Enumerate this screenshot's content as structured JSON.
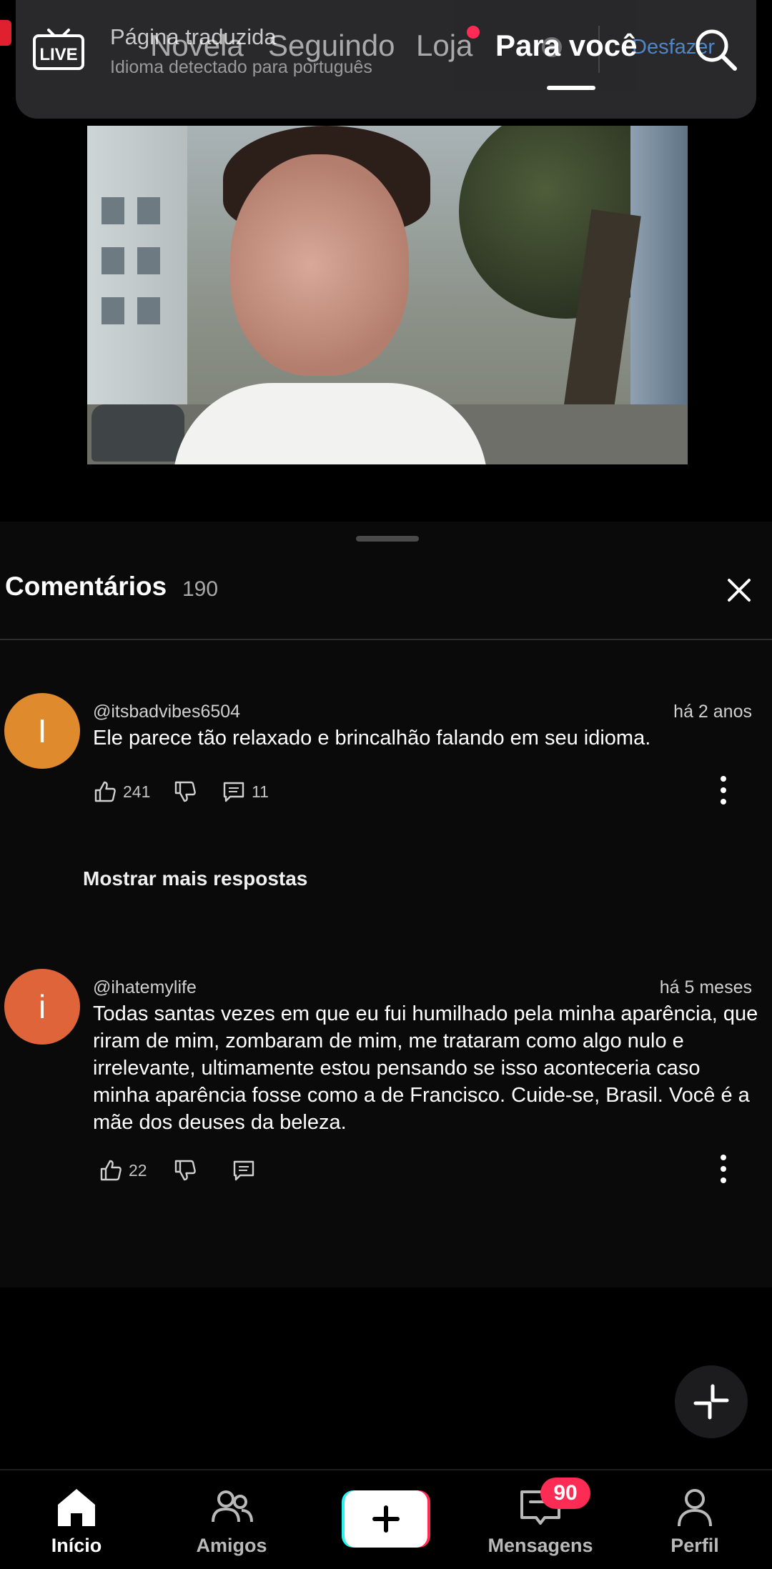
{
  "translation_banner": {
    "title": "Página traduzida",
    "subtitle": "Idioma detectado para português",
    "undo_label": "Desfazer"
  },
  "header": {
    "live_label": "LIVE",
    "tabs": [
      {
        "label": "Novela",
        "active": false
      },
      {
        "label": "Seguindo",
        "active": false
      },
      {
        "label": "Loja",
        "active": false,
        "has_dot": true
      },
      {
        "label": "Para você",
        "active": true
      }
    ]
  },
  "comments_sheet": {
    "title": "Comentários",
    "count": "190",
    "comments": [
      {
        "avatar_letter": "I",
        "avatar_color": "#e08a2e",
        "username": "@itsbadvibes6504",
        "time": "há 2 anos",
        "text": "Ele parece tão relaxado e brincalhão falando em seu idioma.",
        "likes": "241",
        "replies": "11"
      },
      {
        "avatar_letter": "i",
        "avatar_color": "#e0643a",
        "username": "@ihatemylife",
        "time": "há 5 meses",
        "text": "Todas santas vezes em que eu fui humilhado pela minha aparência, que riram de mim, zombaram de mim, me trataram como algo nulo e irrelevante, ultimamente estou pensando se isso aconteceria caso minha aparência fosse como a de Francisco. Cuide-se, Brasil. Você é a mãe dos deuses da beleza.",
        "likes": "22",
        "replies": ""
      }
    ],
    "show_more_replies": "Mostrar mais respostas"
  },
  "bottom_nav": {
    "items": [
      {
        "label": "Início",
        "icon": "home-icon",
        "active": true
      },
      {
        "label": "Amigos",
        "icon": "friends-icon",
        "active": false
      },
      {
        "label": "",
        "icon": "plus-icon",
        "active": false
      },
      {
        "label": "Mensagens",
        "icon": "inbox-icon",
        "active": false,
        "badge": "90"
      },
      {
        "label": "Perfil",
        "icon": "profile-icon",
        "active": false
      }
    ]
  },
  "colors": {
    "accent": "#fe2c55",
    "create_cyan": "#25f4ee"
  }
}
